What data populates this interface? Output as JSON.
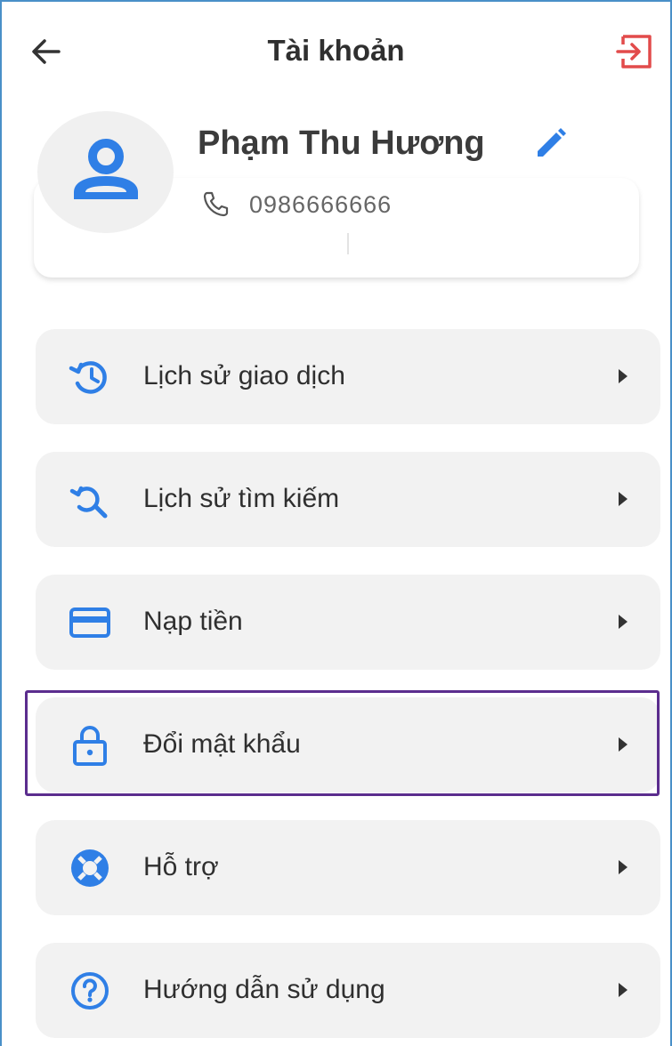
{
  "header": {
    "title": "Tài khoản"
  },
  "profile": {
    "name": "Phạm Thu Hương",
    "phone": "0986666666"
  },
  "menu": [
    {
      "label": "Lịch sử giao dịch",
      "icon": "history-icon"
    },
    {
      "label": "Lịch sử tìm kiếm",
      "icon": "search-history-icon"
    },
    {
      "label": "Nạp tiền",
      "icon": "credit-card-icon"
    },
    {
      "label": "Đổi mật khẩu",
      "icon": "lock-icon"
    },
    {
      "label": "Hỗ trợ",
      "icon": "lifebuoy-icon"
    },
    {
      "label": "Hướng dẫn sử dụng",
      "icon": "help-circle-icon"
    }
  ],
  "colors": {
    "accent": "#2f7fe6",
    "logout": "#e24b4b",
    "highlight": "#5b2d8e",
    "item_bg": "#f2f2f2"
  }
}
